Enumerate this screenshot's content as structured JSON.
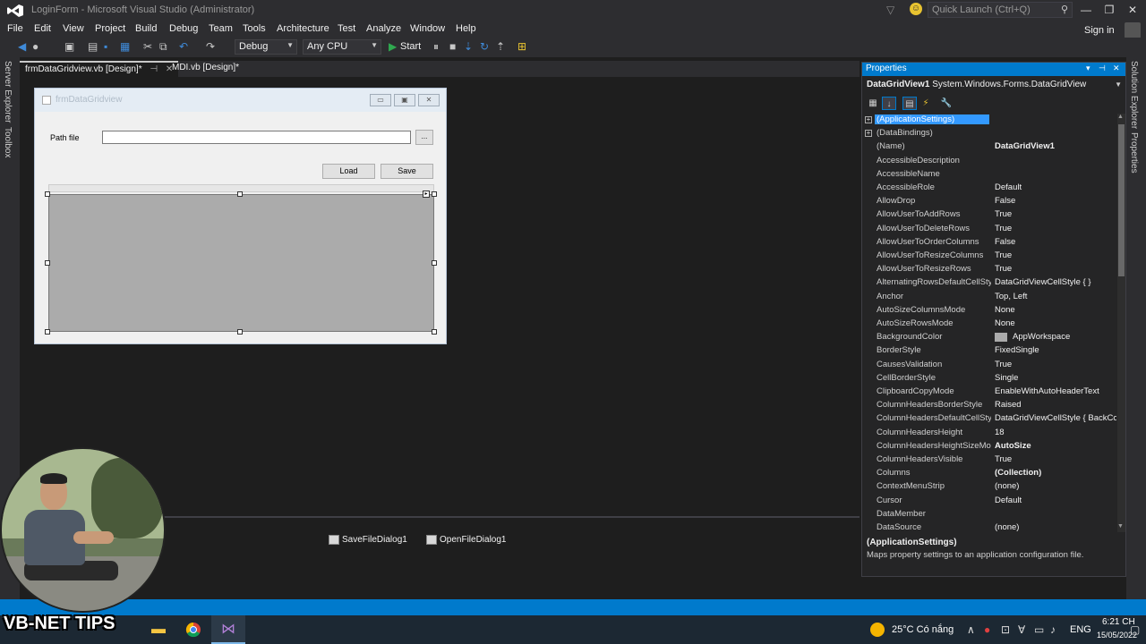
{
  "window": {
    "title": "LoginForm - Microsoft Visual Studio (Administrator)",
    "quick_launch_placeholder": "Quick Launch (Ctrl+Q)",
    "sign_in": "Sign in"
  },
  "menu": [
    "File",
    "Edit",
    "View",
    "Project",
    "Build",
    "Debug",
    "Team",
    "Tools",
    "Architecture",
    "Test",
    "Analyze",
    "Window",
    "Help"
  ],
  "toolbar": {
    "config": "Debug",
    "platform": "Any CPU",
    "start": "Start"
  },
  "left_tabs": [
    "Server Explorer",
    "Toolbox"
  ],
  "right_tabs": [
    "Solution Explorer",
    "Properties"
  ],
  "doc_tabs": [
    {
      "label": "frmDataGridview.vb [Design]*",
      "active": true
    },
    {
      "label": "MDI.vb [Design]*",
      "active": false
    }
  ],
  "form": {
    "title": "frmDataGridview",
    "path_label": "Path file",
    "path_value": "",
    "browse_label": "...",
    "load_label": "Load",
    "save_label": "Save"
  },
  "tray": [
    "SaveFileDialog1",
    "OpenFileDialog1"
  ],
  "properties": {
    "header": "Properties",
    "object_name": "DataGridView1",
    "object_type": "System.Windows.Forms.DataGridView",
    "rows": [
      {
        "name": "(ApplicationSettings)",
        "value": "",
        "expand": true,
        "selected": true
      },
      {
        "name": "(DataBindings)",
        "value": "",
        "expand": true
      },
      {
        "name": "(Name)",
        "value": "DataGridView1",
        "bold": true
      },
      {
        "name": "AccessibleDescription",
        "value": ""
      },
      {
        "name": "AccessibleName",
        "value": ""
      },
      {
        "name": "AccessibleRole",
        "value": "Default"
      },
      {
        "name": "AllowDrop",
        "value": "False"
      },
      {
        "name": "AllowUserToAddRows",
        "value": "True"
      },
      {
        "name": "AllowUserToDeleteRows",
        "value": "True"
      },
      {
        "name": "AllowUserToOrderColumns",
        "value": "False"
      },
      {
        "name": "AllowUserToResizeColumns",
        "value": "True"
      },
      {
        "name": "AllowUserToResizeRows",
        "value": "True"
      },
      {
        "name": "AlternatingRowsDefaultCellSty",
        "value": "DataGridViewCellStyle { }"
      },
      {
        "name": "Anchor",
        "value": "Top, Left"
      },
      {
        "name": "AutoSizeColumnsMode",
        "value": "None"
      },
      {
        "name": "AutoSizeRowsMode",
        "value": "None"
      },
      {
        "name": "BackgroundColor",
        "value": "AppWorkspace",
        "swatch": true
      },
      {
        "name": "BorderStyle",
        "value": "FixedSingle"
      },
      {
        "name": "CausesValidation",
        "value": "True"
      },
      {
        "name": "CellBorderStyle",
        "value": "Single"
      },
      {
        "name": "ClipboardCopyMode",
        "value": "EnableWithAutoHeaderText"
      },
      {
        "name": "ColumnHeadersBorderStyle",
        "value": "Raised"
      },
      {
        "name": "ColumnHeadersDefaultCellSty",
        "value": "DataGridViewCellStyle { BackCol"
      },
      {
        "name": "ColumnHeadersHeight",
        "value": "18"
      },
      {
        "name": "ColumnHeadersHeightSizeMo",
        "value": "AutoSize",
        "bold": true
      },
      {
        "name": "ColumnHeadersVisible",
        "value": "True"
      },
      {
        "name": "Columns",
        "value": "(Collection)",
        "bold": true
      },
      {
        "name": "ContextMenuStrip",
        "value": "(none)"
      },
      {
        "name": "Cursor",
        "value": "Default"
      },
      {
        "name": "DataMember",
        "value": ""
      },
      {
        "name": "DataSource",
        "value": "(none)"
      }
    ],
    "description_title": "(ApplicationSettings)",
    "description": "Maps property settings to an application configuration file."
  },
  "taskbar": {
    "weather": "25°C Có nắng",
    "language": "ENG",
    "time": "6:21 CH",
    "date": "15/05/2022"
  },
  "overlay": {
    "logo": "VB-NET TIPS"
  },
  "colors": {
    "accent": "#007acc",
    "background": "#1e1e1e",
    "chrome": "#2d2d30",
    "grid_bg": "#ababab"
  }
}
